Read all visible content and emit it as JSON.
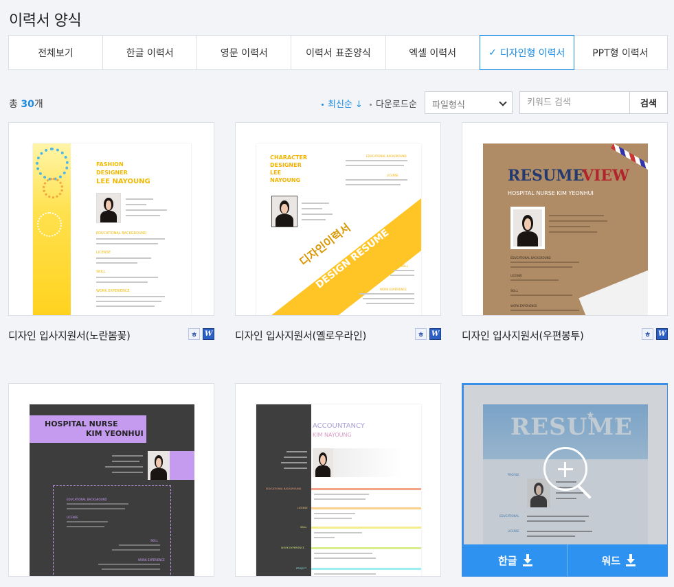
{
  "page": {
    "title": "이력서 양식"
  },
  "tabs": [
    {
      "label": "전체보기",
      "active": false
    },
    {
      "label": "한글 이력서",
      "active": false
    },
    {
      "label": "영문 이력서",
      "active": false
    },
    {
      "label": "이력서 표준양식",
      "active": false
    },
    {
      "label": "엑셀 이력서",
      "active": false
    },
    {
      "label": "디자인형 이력서",
      "active": true
    },
    {
      "label": "PPT형 이력서",
      "active": false
    }
  ],
  "toolbar": {
    "count_prefix": "총",
    "count_value": "30",
    "count_suffix": "개",
    "sort_latest": "최신순 ↓",
    "sort_download": "다운로드순",
    "file_type_select": "파일형식",
    "search_placeholder": "키워드 검색",
    "search_button": "검색"
  },
  "cards": [
    {
      "title": "디자인 입사지원서(노란봄꽃)",
      "thumb": {
        "l1": "FASHION",
        "l2": "DESIGNER",
        "l3": "LEE NAYOUNG",
        "s1": "EDUCATIONAL BACKGROUND",
        "s2": "LICENSE",
        "s3": "SKILL",
        "s4": "WORK EXPERIENCE"
      }
    },
    {
      "title": "디자인 입사지원서(옐로우라인)",
      "thumb": {
        "l1": "CHARACTER",
        "l2": "DESIGNER",
        "l3": "LEE",
        "l4": "NAYOUNG",
        "band1": "디자인이력서",
        "band2": "DESIGN RESUME",
        "s1": "EDUCATIONAL BACKGROUND",
        "s2": "LICENSE",
        "s3": "SKILL",
        "s4": "WORK EXPERIENCE"
      }
    },
    {
      "title": "디자인 입사지원서(우편봉투)",
      "thumb": {
        "title_a": "RESUME",
        "title_b": "VIEW",
        "subtitle": "HOSPITAL NURSE KIM YEONHUI",
        "s1": "EDUCATIONAL BACKGROUND",
        "s2": "LICENSE",
        "s3": "SKILL",
        "s4": "WORK EXPERIENCE"
      }
    },
    {
      "title": "",
      "thumb": {
        "l1": "HOSPITAL NURSE",
        "l2": "KIM YEONHUI",
        "s1": "EDUCATIONAL BACKGROUND",
        "s2": "LICENSE",
        "s3": "SKILL",
        "s4": "WORK EXPERIENCE"
      }
    },
    {
      "title": "",
      "thumb": {
        "l1": "ACCOUNTANCY",
        "l2": "KIM NAYOUNG",
        "s1": "EDUCATIONAL BACKGROUND",
        "s2": "LICENSE",
        "s3": "SKILL",
        "s4": "WORK EXPERIENCE",
        "s5": "PROJECT"
      }
    },
    {
      "title": "",
      "thumb": {
        "title": "RESUME",
        "s0": "PROFILE",
        "s1": "EDUCATIONAL",
        "s2": "LICENSE"
      },
      "download": {
        "hwp": "한글",
        "word": "워드"
      }
    }
  ],
  "icons": {
    "hwp": "hwp-file-icon",
    "word": "word-file-icon",
    "zoom": "zoom-in-icon",
    "download": "download-icon",
    "check": "check-icon"
  },
  "colors": {
    "accent": "#1a8be0",
    "download_bar": "#2e93f0"
  }
}
